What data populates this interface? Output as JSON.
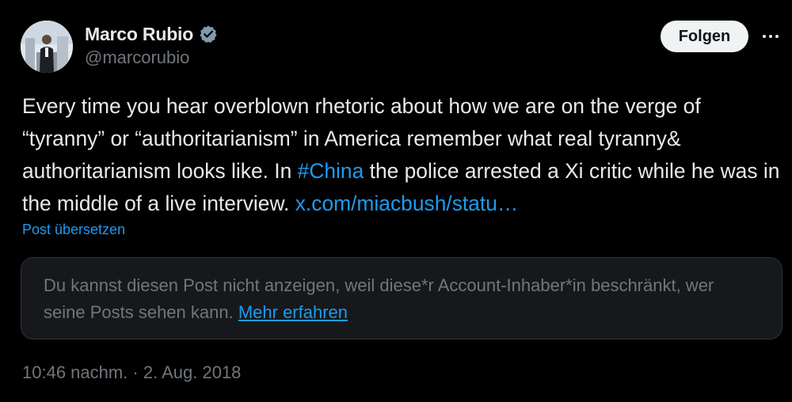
{
  "author": {
    "display_name": "Marco Rubio",
    "handle": "@marcorubio",
    "verified": true,
    "avatar_icon": "profile-photo"
  },
  "actions": {
    "follow_label": "Folgen",
    "more_icon": "more-horizontal-icon"
  },
  "tweet": {
    "text_part1": "Every time you hear overblown rhetoric about how we are on the verge of “tyranny” or “authoritarianism” in America remember what real tyranny& authoritarianism looks like. In ",
    "hashtag": "#China",
    "text_part2": " the police arrested a Xi critic while he was in the middle of a live interview. ",
    "link": "x.com/miacbush/statu…",
    "translate_label": "Post übersetzen"
  },
  "quoted_post": {
    "unavailable_text": "Du kannst diesen Post nicht anzeigen, weil diese*r Account-Inhaber*in beschränkt, wer seine Posts sehen kann. ",
    "learn_more_label": "Mehr erfahren"
  },
  "meta": {
    "timestamp": "10:46 nachm. · 2. Aug. 2018"
  },
  "colors": {
    "background": "#000000",
    "text_primary": "#e7e9ea",
    "text_secondary": "#71767b",
    "link": "#1d9bf0",
    "follow_button_bg": "#eff3f4",
    "verified_badge": "#829aab"
  }
}
